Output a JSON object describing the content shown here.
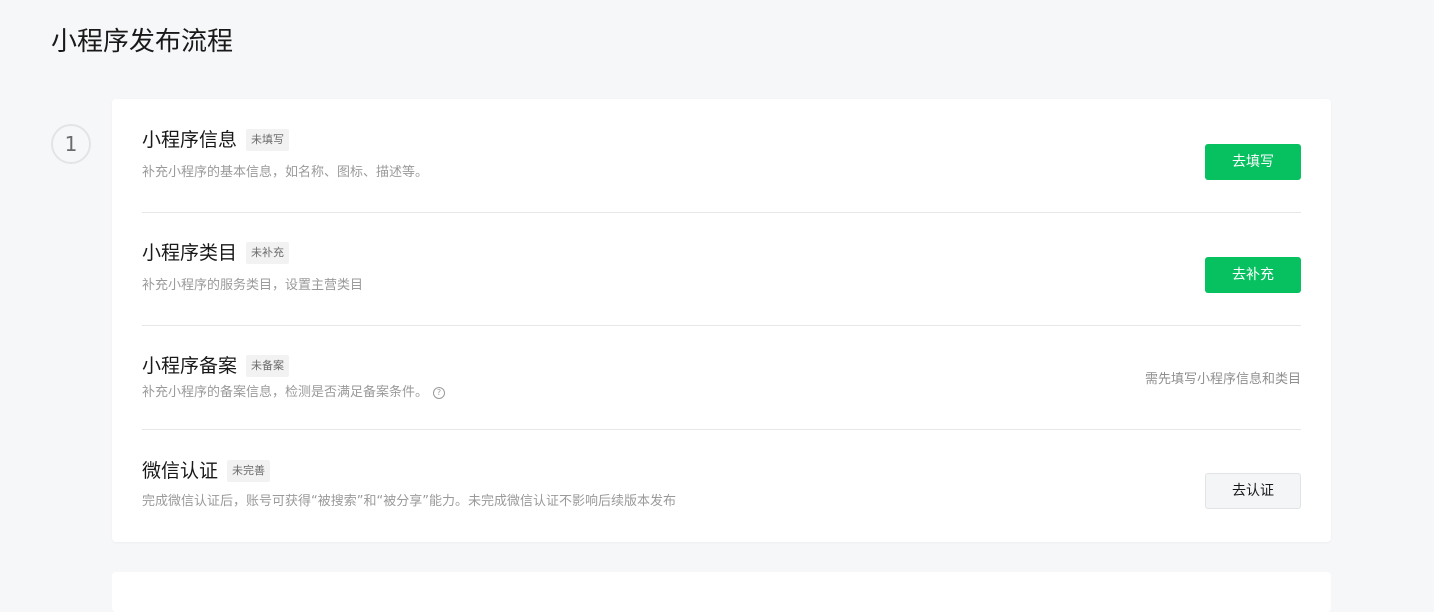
{
  "page": {
    "title": "小程序发布流程"
  },
  "step": {
    "number": "1"
  },
  "items": [
    {
      "title": "小程序信息",
      "badge": "未填写",
      "description": "补充小程序的基本信息，如名称、图标、描述等。",
      "action_label": "去填写"
    },
    {
      "title": "小程序类目",
      "badge": "未补充",
      "description": "补充小程序的服务类目，设置主营类目",
      "action_label": "去补充"
    },
    {
      "title": "小程序备案",
      "badge": "未备案",
      "description": "补充小程序的备案信息，检测是否满足备案条件。",
      "help_icon": "?",
      "hint": "需先填写小程序信息和类目"
    },
    {
      "title": "微信认证",
      "badge": "未完善",
      "description": "完成微信认证后，账号可获得“被搜索”和“被分享”能力。未完成微信认证不影响后续版本发布",
      "action_label": "去认证"
    }
  ],
  "colors": {
    "primary": "#07c160",
    "background": "#f6f7f9"
  },
  "icons": {
    "help": "question-circle-icon"
  }
}
